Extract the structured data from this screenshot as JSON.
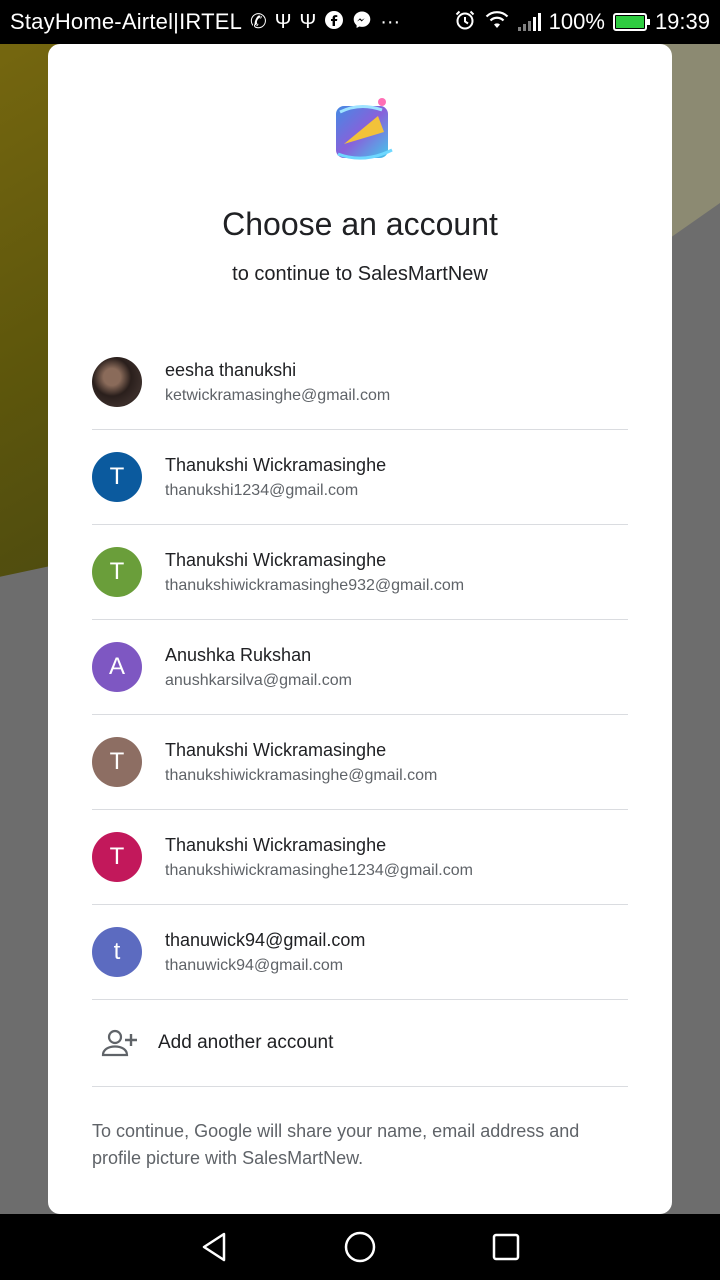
{
  "statusbar": {
    "carrier": "StayHome-Airtel|IRTEL",
    "battery": "100%",
    "time": "19:39"
  },
  "dialog": {
    "title": "Choose an account",
    "subtitle": "to continue to SalesMartNew",
    "accounts": [
      {
        "name": "eesha thanukshi",
        "email": "ketwickramasinghe@gmail.com",
        "initial": "",
        "color": ""
      },
      {
        "name": "Thanukshi Wickramasinghe",
        "email": "thanukshi1234@gmail.com",
        "initial": "T",
        "color": "#0b5a9e"
      },
      {
        "name": "Thanukshi Wickramasinghe",
        "email": "thanukshiwickramasinghe932@gmail.com",
        "initial": "T",
        "color": "#6a9e3a"
      },
      {
        "name": "Anushka Rukshan",
        "email": "anushkarsilva@gmail.com",
        "initial": "A",
        "color": "#7e57c2"
      },
      {
        "name": "Thanukshi Wickramasinghe",
        "email": "thanukshiwickramasinghe@gmail.com",
        "initial": "T",
        "color": "#8d6e63"
      },
      {
        "name": "Thanukshi Wickramasinghe",
        "email": "thanukshiwickramasinghe1234@gmail.com",
        "initial": "T",
        "color": "#c2185b"
      },
      {
        "name": "thanuwick94@gmail.com",
        "email": "thanuwick94@gmail.com",
        "initial": "t",
        "color": "#5c6bc0"
      }
    ],
    "add_account_label": "Add another account",
    "footer": "To continue, Google will share your name, email address and profile picture with SalesMartNew."
  }
}
